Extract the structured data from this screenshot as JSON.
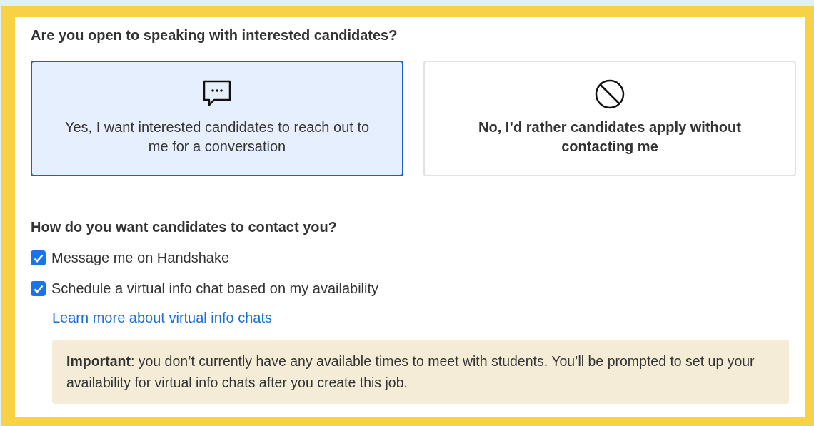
{
  "question": "Are you open to speaking with interested candidates?",
  "options": [
    {
      "kind": "chat",
      "label": "Yes, I want interested candidates to reach out to me for a conversation",
      "selected": true
    },
    {
      "kind": "blocked",
      "label": "No, I’d rather candidates apply without contacting me",
      "selected": false
    }
  ],
  "contact_question": "How do you want candidates to contact you?",
  "contact_methods": [
    {
      "label": "Message me on Handshake",
      "checked": true
    },
    {
      "label": "Schedule a virtual info chat based on my availability",
      "checked": true
    }
  ],
  "learn_more_link": "Learn more about virtual info chats",
  "notice": "**Important**: you don’t currently have any available times to meet with students. You’ll be prompted to set up your availability for virtual info chats after you create this job."
}
